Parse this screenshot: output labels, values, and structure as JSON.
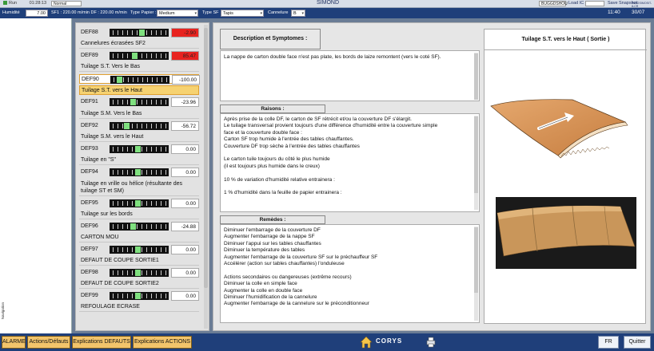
{
  "topbar": {
    "run_label": "Run",
    "run_time": "01:28:13",
    "mode_value": "Normal",
    "app_title": "SIMOND",
    "user_value": "BUGGDSHOU",
    "load_ic_label": "Load IC",
    "save_label": "Save",
    "snapshot_label": "Snapshot",
    "workstation_label": "AVAGSIMOSIT-8-CR"
  },
  "params": {
    "humidite_label": "Humidité",
    "humidite_value": "7.00",
    "sf_info": "SF1 : 220.00 m/min DF : 220.00 m/min",
    "type_papier_label": "Type Papier :",
    "type_papier_value": "Medium",
    "type_sf_label": "Type SF",
    "type_sf_value": "Tapis",
    "cannelure_label": "Cannelure",
    "cannelure_value": "B",
    "time": "11:40",
    "date": "30/07"
  },
  "leftstrip": {
    "nav_label": "Navigation"
  },
  "defaults": {
    "def88": {
      "code": "DEF88",
      "value": "-2.90",
      "marker": 0.56
    },
    "title_sf2": "Cannelures écrasées SF2",
    "def89": {
      "code": "DEF89",
      "value": "85.47",
      "marker": 0.42
    },
    "title_st_bas": "Tuilage S.T. Vers le Bas",
    "def90": {
      "code": "DEF90",
      "value": "-100.00",
      "marker": 0.12
    },
    "title_st_haut": "Tuilage S.T. vers le Haut",
    "def91": {
      "code": "DEF91",
      "value": "-23.96",
      "marker": 0.4
    },
    "title_sm_bas": "Tuilage S.M. Vers le Bas",
    "def92": {
      "code": "DEF92",
      "value": "-56.72",
      "marker": 0.28
    },
    "title_sm_haut": "Tuilage S.M. vers le Haut",
    "def93": {
      "code": "DEF93",
      "value": "0.00",
      "marker": 0.48
    },
    "title_s": "Tuilage en \"S\"",
    "def94": {
      "code": "DEF94",
      "value": "0.00",
      "marker": 0.48
    },
    "title_vrille_1": "Tuilage en vrille ou hélice (résultante des",
    "title_vrille_2": "tuilage ST et SM)",
    "def95": {
      "code": "DEF95",
      "value": "0.00",
      "marker": 0.48
    },
    "title_bords": "Tuilage sur les bords",
    "def96": {
      "code": "DEF96",
      "value": "-24.88",
      "marker": 0.4
    },
    "title_carton_mou": "CARTON MOU",
    "def97": {
      "code": "DEF97",
      "value": "0.00",
      "marker": 0.48
    },
    "title_coupe1": "DEFAUT DE COUPE SORTIE1",
    "def98": {
      "code": "DEF98",
      "value": "0.00",
      "marker": 0.48
    },
    "title_coupe2": "DEFAUT DE COUPE SORTIE2",
    "def99": {
      "code": "DEF99",
      "value": "0.00",
      "marker": 0.48
    },
    "title_refoulage": "REFOULAGE ECRASE",
    "alarm_color": "#e8231f",
    "marker_color": "#7fe07f",
    "selected_color": "#f6d271"
  },
  "description": {
    "header": "Description et Symptomes :",
    "text": "La nappe de carton double face n'est pas plate, les bords de laize remontent (vers le coté SF)."
  },
  "raisons": {
    "header": "Raisons :",
    "lines": [
      "Après prise de la colle DF, le carton de SF rétrécit et/ou la couverture DF s'élargit.",
      "Le tuilage transversal provient toujours d'une différence d'humidité entre la couverture simple",
      "face et la couverture double face :",
      "Carton SF trop humide à l'entrée des tables chauffantes.",
      "Couverture DF trop sèche à l'entrée des tables chauffantes",
      "",
      "Le carton tuile toujours du côté le plus humide",
      "(il est toujours plus humide dans le creux)",
      "",
      "10 % de variation d'humidité relative entrainera :",
      "",
      " 1 % d'humidité dans la feuille de papier entrainera :"
    ]
  },
  "remedes": {
    "header": "Remèdes :",
    "lines": [
      "Diminuer l'embarrage de la couverture DF",
      "Augmenter l'embarrage de la nappe SF",
      "Diminuer l'appui sur les tables chauffantes",
      "Diminuer la température des tables",
      "Augmenter l'embarrage de la couverture SF sur le préchauffeur SF",
      "Accélérer (action sur tables chauffantes) l'onduleuse",
      "",
      "Actions secondaires ou dangereuses (extrême recours)",
      "Diminuer la colle en simple face",
      "Augmenter la colle en double face",
      "Diminuer l'humidification de la cannelure",
      "Augmenter l'embarrage de la cannelure sur le préconditionneur"
    ]
  },
  "illustration": {
    "title": "Tuilage S.T. vers le Haut  ( Sortie )",
    "board_color": "#d9955a",
    "photo_color": "#c79a5e"
  },
  "bottombar": {
    "alarme": "ALARME",
    "actions": "Actions/Défauts",
    "explications_defauts": "Explications DEFAUTS",
    "explications_actions": "Explications ACTIONS",
    "logo": "CORYS",
    "lang": "FR",
    "quit": "Quitter"
  }
}
